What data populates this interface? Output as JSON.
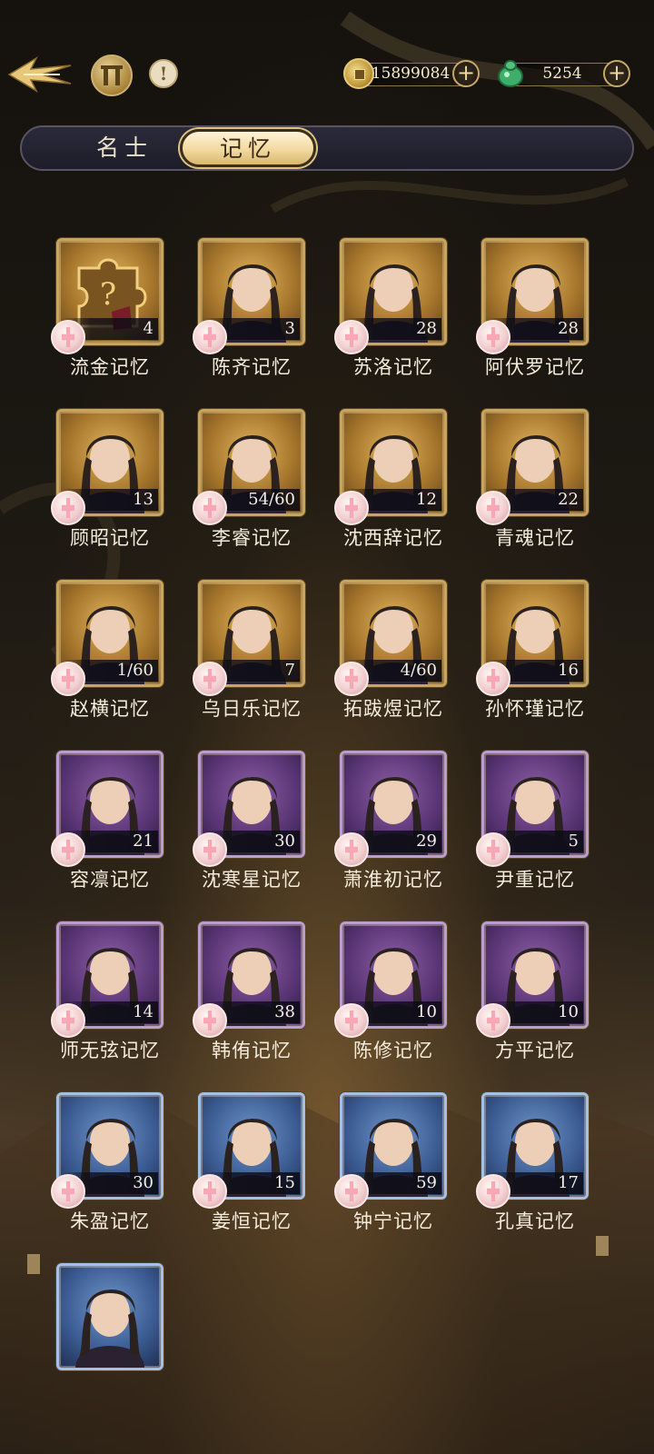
{
  "header": {
    "back_icon": "winged-arrow-back-icon",
    "pillar_icon": "pavilion-gate-icon",
    "info_icon": "exclamation-icon",
    "info_label": "!",
    "coins": {
      "value": "15899084",
      "icon": "copper-coin-icon",
      "plus": "+"
    },
    "jade": {
      "value": "5254",
      "icon": "jade-gourd-icon",
      "plus": "+"
    }
  },
  "tabs": [
    {
      "label": "名士",
      "active": false
    },
    {
      "label": "记忆",
      "active": true
    }
  ],
  "colors": {
    "gold": "#c8a45e",
    "purple": "#8e5fa6",
    "blue": "#6f95c9",
    "accent": "#f2d99e"
  },
  "memories": [
    {
      "name": "流金记忆",
      "count": "4",
      "frame": "gold",
      "portrait": "puzzle-piece-icon"
    },
    {
      "name": "陈齐记忆",
      "count": "3",
      "frame": "gold",
      "portrait": "character-portrait"
    },
    {
      "name": "苏洛记忆",
      "count": "28",
      "frame": "gold",
      "portrait": "character-portrait"
    },
    {
      "name": "阿伏罗记忆",
      "count": "28",
      "frame": "gold",
      "portrait": "character-portrait"
    },
    {
      "name": "顾昭记忆",
      "count": "13",
      "frame": "gold",
      "portrait": "character-portrait"
    },
    {
      "name": "李睿记忆",
      "count": "54/60",
      "frame": "gold",
      "portrait": "character-portrait"
    },
    {
      "name": "沈西辞记忆",
      "count": "12",
      "frame": "gold",
      "portrait": "character-portrait"
    },
    {
      "name": "青魂记忆",
      "count": "22",
      "frame": "gold",
      "portrait": "character-portrait"
    },
    {
      "name": "赵横记忆",
      "count": "1/60",
      "frame": "gold",
      "portrait": "character-portrait"
    },
    {
      "name": "乌日乐记忆",
      "count": "7",
      "frame": "gold",
      "portrait": "character-portrait"
    },
    {
      "name": "拓跋煜记忆",
      "count": "4/60",
      "frame": "gold",
      "portrait": "character-portrait"
    },
    {
      "name": "孙怀瑾记忆",
      "count": "16",
      "frame": "gold",
      "portrait": "character-portrait"
    },
    {
      "name": "容凛记忆",
      "count": "21",
      "frame": "purple",
      "portrait": "character-portrait"
    },
    {
      "name": "沈寒星记忆",
      "count": "30",
      "frame": "purple",
      "portrait": "character-portrait"
    },
    {
      "name": "萧淮初记忆",
      "count": "29",
      "frame": "purple",
      "portrait": "character-portrait"
    },
    {
      "name": "尹重记忆",
      "count": "5",
      "frame": "purple",
      "portrait": "character-portrait"
    },
    {
      "name": "师无弦记忆",
      "count": "14",
      "frame": "purple",
      "portrait": "character-portrait"
    },
    {
      "name": "韩侑记忆",
      "count": "38",
      "frame": "purple",
      "portrait": "character-portrait"
    },
    {
      "name": "陈修记忆",
      "count": "10",
      "frame": "purple",
      "portrait": "character-portrait"
    },
    {
      "name": "方平记忆",
      "count": "10",
      "frame": "purple",
      "portrait": "character-portrait"
    },
    {
      "name": "朱盈记忆",
      "count": "30",
      "frame": "blue",
      "portrait": "character-portrait"
    },
    {
      "name": "姜恒记忆",
      "count": "15",
      "frame": "blue",
      "portrait": "character-portrait"
    },
    {
      "name": "钟宁记忆",
      "count": "59",
      "frame": "blue",
      "portrait": "character-portrait"
    },
    {
      "name": "孔真记忆",
      "count": "17",
      "frame": "blue",
      "portrait": "character-portrait"
    },
    {
      "name": "",
      "count": "",
      "frame": "blue",
      "portrait": "character-portrait"
    }
  ]
}
